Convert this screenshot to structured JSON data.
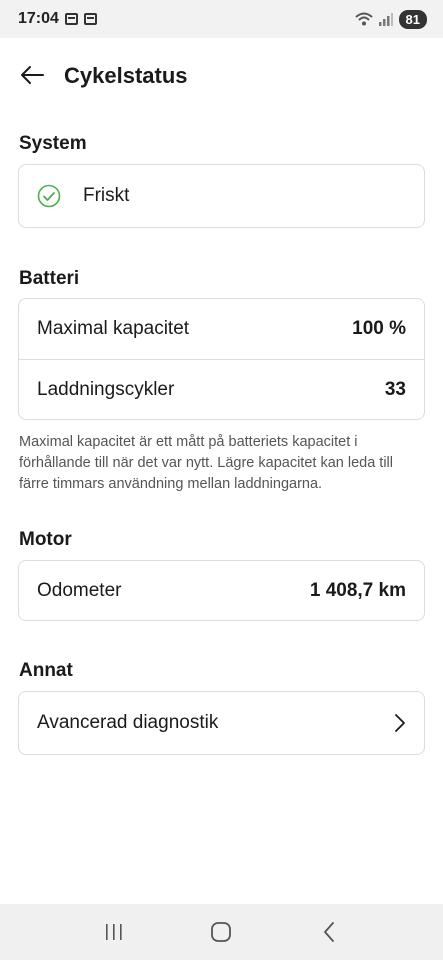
{
  "status_bar": {
    "time": "17:04",
    "battery": "81"
  },
  "header": {
    "title": "Cykelstatus"
  },
  "sections": {
    "system": {
      "title": "System",
      "status_label": "Friskt"
    },
    "battery": {
      "title": "Batteri",
      "rows": [
        {
          "label": "Maximal kapacitet",
          "value": "100 %"
        },
        {
          "label": "Laddningscykler",
          "value": "33"
        }
      ],
      "note": "Maximal kapacitet är ett mått på batteriets kapacitet i förhållande till när det var nytt. Lägre kapacitet kan leda till färre timmars användning mellan laddningarna."
    },
    "motor": {
      "title": "Motor",
      "rows": [
        {
          "label": "Odometer",
          "value": "1 408,7 km"
        }
      ]
    },
    "other": {
      "title": "Annat",
      "rows": [
        {
          "label": "Avancerad diagnostik"
        }
      ]
    }
  },
  "icons": {
    "status": "check-circle-icon",
    "back": "arrow-left-icon",
    "chevron": "chevron-right-icon"
  },
  "colors": {
    "status_ok": "#4caf50"
  }
}
